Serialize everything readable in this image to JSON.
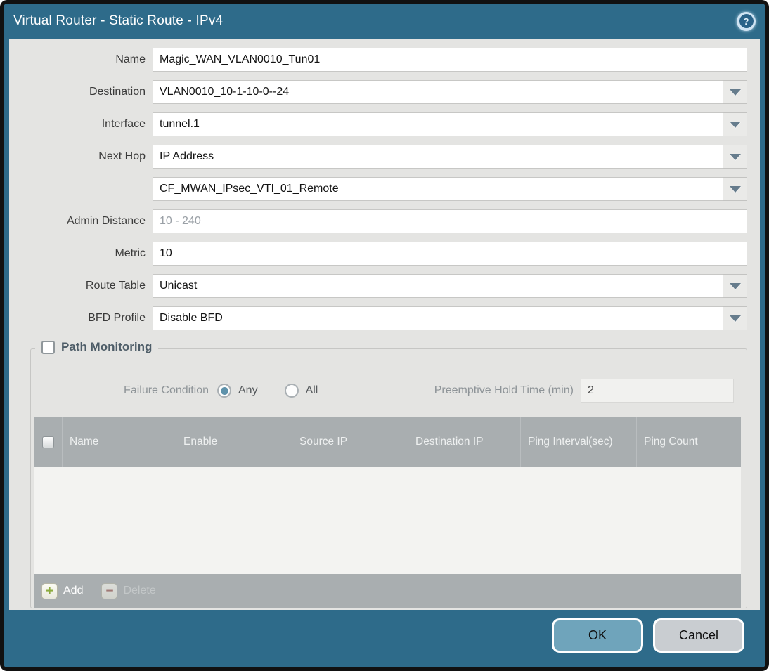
{
  "dialog": {
    "title": "Virtual Router - Static Route - IPv4",
    "help_glyph": "?"
  },
  "form": {
    "name": {
      "label": "Name",
      "value": "Magic_WAN_VLAN0010_Tun01"
    },
    "destination": {
      "label": "Destination",
      "value": "VLAN0010_10-1-10-0--24"
    },
    "interface": {
      "label": "Interface",
      "value": "tunnel.1"
    },
    "next_hop": {
      "label": "Next Hop",
      "value": "IP Address",
      "address_value": "CF_MWAN_IPsec_VTI_01_Remote"
    },
    "admin_distance": {
      "label": "Admin Distance",
      "value": "",
      "placeholder": "10 - 240"
    },
    "metric": {
      "label": "Metric",
      "value": "10"
    },
    "route_table": {
      "label": "Route Table",
      "value": "Unicast"
    },
    "bfd_profile": {
      "label": "BFD Profile",
      "value": "Disable BFD"
    }
  },
  "path_monitoring": {
    "title": "Path Monitoring",
    "enabled": false,
    "failure_condition": {
      "label": "Failure Condition",
      "options": [
        "Any",
        "All"
      ],
      "selected": "Any"
    },
    "preemptive_hold_time": {
      "label": "Preemptive Hold Time (min)",
      "value": "2"
    },
    "table": {
      "columns": [
        "Name",
        "Enable",
        "Source IP",
        "Destination IP",
        "Ping Interval(sec)",
        "Ping Count"
      ],
      "rows": []
    },
    "add_label": "Add",
    "delete_label": "Delete"
  },
  "footer": {
    "ok_label": "OK",
    "cancel_label": "Cancel"
  },
  "colors": {
    "titlebar_teal": "#2e6b8a",
    "content_gray": "#e4e4e2",
    "table_header_gray": "#a9aeb0",
    "ok_button": "#6fa4bb",
    "cancel_button": "#c9cdd1",
    "radio_selected": "#5e92ab",
    "add_icon_green": "#8cab3e",
    "delete_icon_red": "#9c5a52"
  }
}
